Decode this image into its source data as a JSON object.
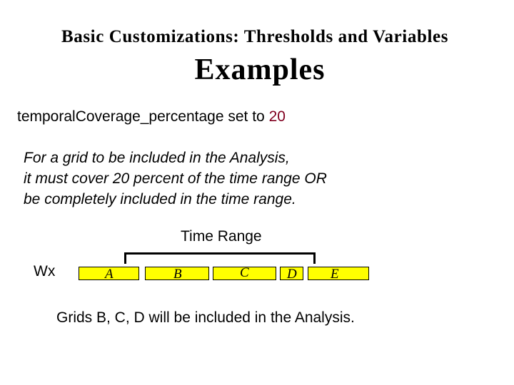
{
  "header": {
    "subtitle": "Basic Customizations: Thresholds and Variables",
    "title": "Examples"
  },
  "setting": {
    "text": "temporalCoverage_percentage set to ",
    "value": "20",
    "value_color": "#800020"
  },
  "rule": {
    "lines": [
      "For a grid to be included in the Analysis,",
      "it must cover 20 percent of the time range OR",
      "be completely included in the time range."
    ]
  },
  "diagram": {
    "range_label": "Time Range",
    "row_label": "Wx",
    "grid_color": "#ffff00",
    "grids": [
      {
        "label": "A"
      },
      {
        "label": "B"
      },
      {
        "label": "C"
      },
      {
        "label": "D"
      },
      {
        "label": "E"
      }
    ]
  },
  "result": "Grids B, C, D will be included in the Analysis."
}
